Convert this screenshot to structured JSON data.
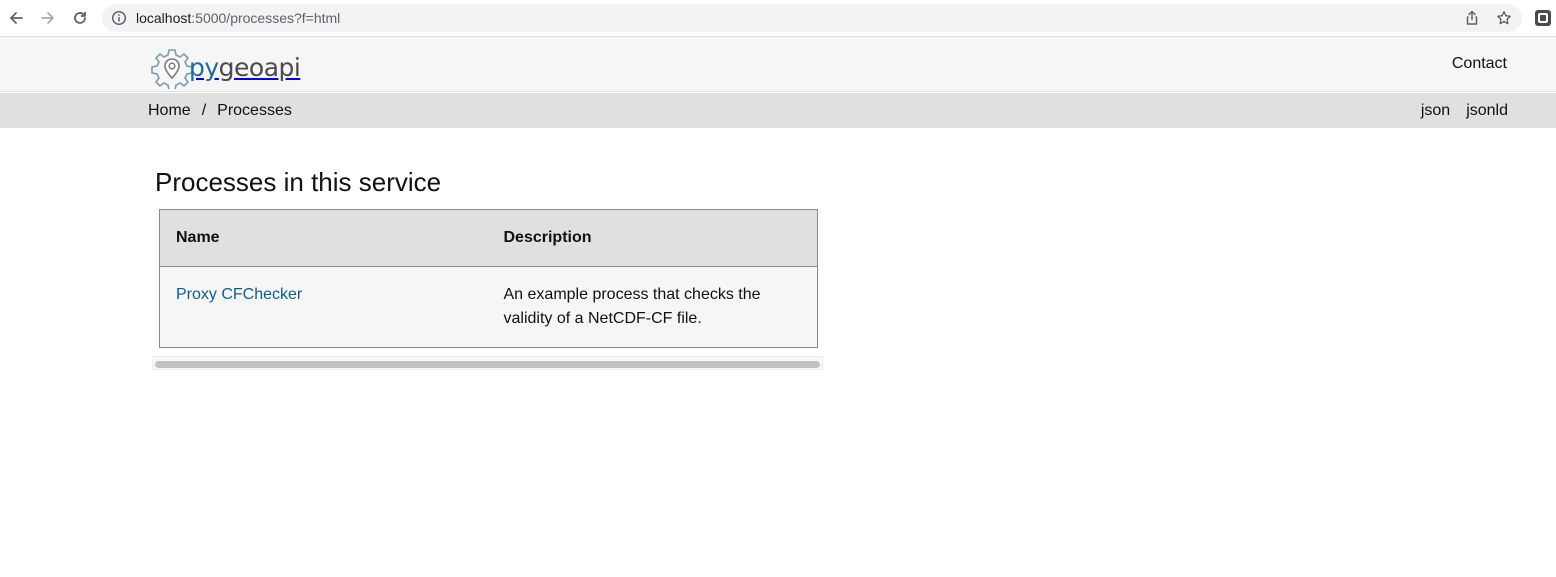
{
  "browser": {
    "url_host": "localhost",
    "url_path": ":5000/processes?f=html"
  },
  "header": {
    "logo_py": "py",
    "logo_rest": "geoapi",
    "contact_label": "Contact"
  },
  "breadcrumb": {
    "items": [
      "Home",
      "Processes"
    ],
    "separator": "/"
  },
  "formats": [
    "json",
    "jsonld"
  ],
  "main": {
    "title": "Processes in this service",
    "table": {
      "headers": [
        "Name",
        "Description"
      ],
      "rows": [
        {
          "name": "Proxy CFChecker",
          "description": "An example process that checks the validity of a NetCDF-CF file."
        }
      ]
    }
  },
  "colors": {
    "link": "#0d5e91",
    "logo_accent": "#1f6aa5",
    "header_bg": "#f6f6f6",
    "crumb_bg": "#e0e0e0"
  }
}
